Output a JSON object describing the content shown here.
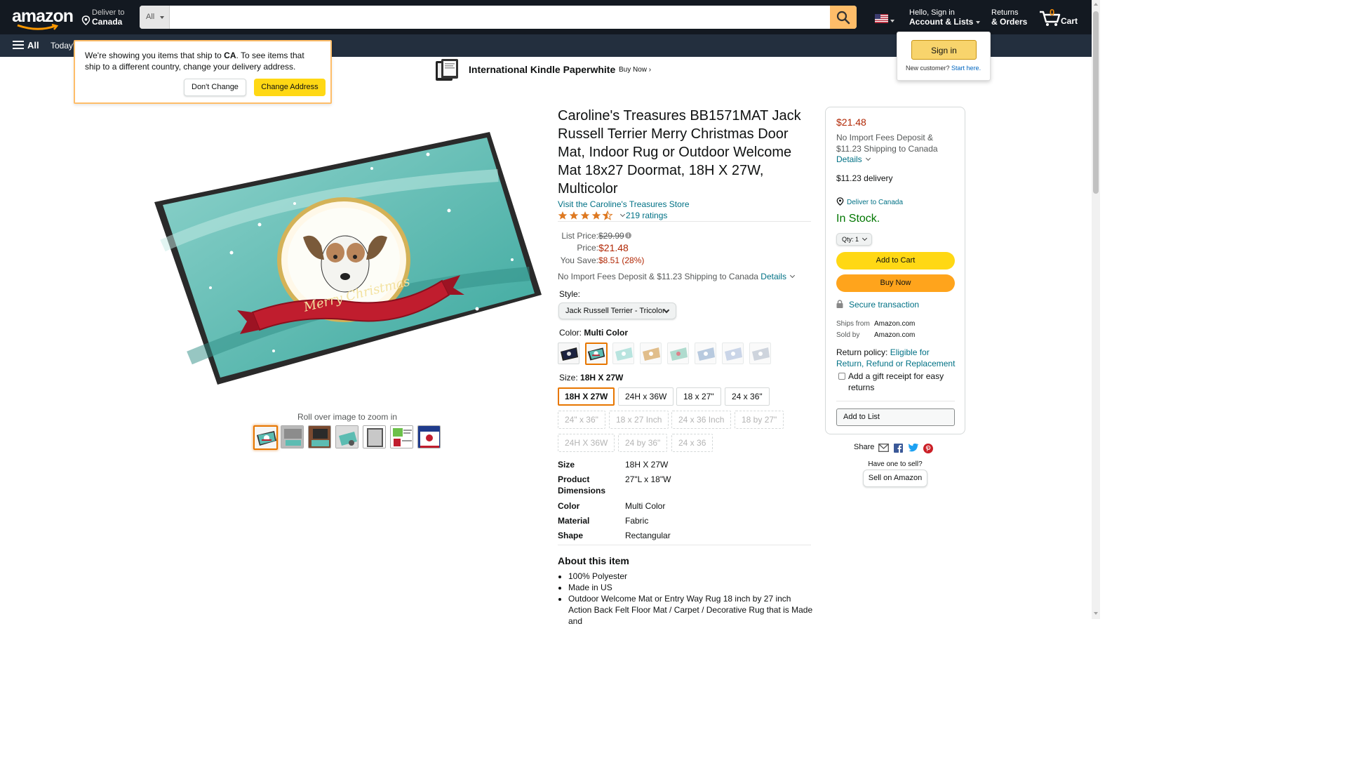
{
  "nav": {
    "logo_text": "amazon",
    "deliver_line1": "Deliver to",
    "deliver_line2": "Canada",
    "search_category": "All",
    "search_placeholder": "",
    "account_line1": "Hello, Sign in",
    "account_line2": "Account & Lists",
    "returns_line1": "Returns",
    "returns_line2": "& Orders",
    "cart_count": "0",
    "cart_label": "Cart",
    "all_label": "All",
    "today_label": "Today's"
  },
  "ship_popover": {
    "text_before": "We're showing you items that ship to ",
    "text_country": "CA",
    "text_after": ". To see items that ship to a different country, change your delivery address.",
    "dont_change": "Don't Change",
    "change_address": "Change Address"
  },
  "signin_popover": {
    "button": "Sign in",
    "new_customer": "New customer?",
    "start_here": "Start here."
  },
  "banner": {
    "title": "International Kindle Paperwhite",
    "cta": "Buy Now ›"
  },
  "gallery": {
    "zoom_hint": "Roll over image to zoom in",
    "mat_text": "Merry Christmas"
  },
  "product": {
    "title": "Caroline's Treasures BB1571MAT Jack Russell Terrier Merry Christmas Door Mat, Indoor Rug or Outdoor Welcome Mat 18x27 Doormat, 18H X 27W, Multicolor",
    "store_link": "Visit the Caroline's Treasures Store",
    "rating": 4.5,
    "ratings_count": "219 ratings",
    "list_price_label": "List Price:",
    "list_price": "$29.99",
    "price_label": "Price:",
    "price": "$21.48",
    "save_label": "You Save:",
    "save_value": "$8.51 (28%)",
    "import_note": "No Import Fees Deposit & $11.23 Shipping to Canada",
    "details_link": "Details",
    "style_label": "Style:",
    "style_value": "Jack Russell Terrier - Tricolor",
    "color_label": "Color: ",
    "color_value": "Multi Color",
    "size_label": "Size: ",
    "size_value": "18H X 27W",
    "sizes": [
      {
        "label": "18H X 27W",
        "state": "selected"
      },
      {
        "label": "24H x 36W",
        "state": "available"
      },
      {
        "label": "18 x 27\"",
        "state": "available"
      },
      {
        "label": "24 x 36\"",
        "state": "available"
      },
      {
        "label": "24\" x 36\"",
        "state": "unavailable"
      },
      {
        "label": "18 x 27 Inch",
        "state": "unavailable"
      },
      {
        "label": "24 x 36 Inch",
        "state": "unavailable"
      },
      {
        "label": "18 by 27\"",
        "state": "unavailable"
      },
      {
        "label": "24H X 36W",
        "state": "unavailable"
      },
      {
        "label": "24 by 36\"",
        "state": "unavailable"
      },
      {
        "label": "24 x 36",
        "state": "unavailable"
      }
    ],
    "specs": [
      {
        "key": "Size",
        "value": "18H X 27W"
      },
      {
        "key": "Product Dimensions",
        "value": "27\"L x 18\"W"
      },
      {
        "key": "Color",
        "value": "Multi Color"
      },
      {
        "key": "Material",
        "value": "Fabric"
      },
      {
        "key": "Shape",
        "value": "Rectangular"
      }
    ],
    "about_title": "About this item",
    "about_items": [
      "100% Polyester",
      "Made in US",
      "Outdoor Welcome Mat or Entry Way Rug 18 inch by 27 inch Action Back Felt Floor Mat / Carpet / Decorative Rug that is Made and"
    ]
  },
  "buybox": {
    "price": "$21.48",
    "import_note": "No Import Fees Deposit & $11.23 Shipping to Canada",
    "details": "Details",
    "delivery": "$11.23 delivery",
    "deliver_to": "Deliver to Canada",
    "stock": "In Stock.",
    "qty_label": "Qty:",
    "qty_value": "1",
    "add_to_cart": "Add to Cart",
    "buy_now": "Buy Now",
    "secure": "Secure transaction",
    "ships_from_label": "Ships from",
    "ships_from_value": "Amazon.com",
    "sold_by_label": "Sold by",
    "sold_by_value": "Amazon.com",
    "return_label": "Return policy: ",
    "return_link": "Eligible for Return, Refund or Replacement",
    "gift_receipt": "Add a gift receipt for easy returns",
    "add_to_list": "Add to List"
  },
  "share": {
    "label": "Share",
    "have_one": "Have one to sell?",
    "sell_button": "Sell on Amazon"
  },
  "colors": {
    "nav_bg": "#131921",
    "subnav_bg": "#232f3e",
    "search_btn": "#febd69",
    "price_red": "#b12704",
    "link": "#007185",
    "stock_green": "#007600",
    "add_to_cart": "#ffd814",
    "buy_now": "#ffa41c",
    "selected_orange": "#e77600"
  }
}
